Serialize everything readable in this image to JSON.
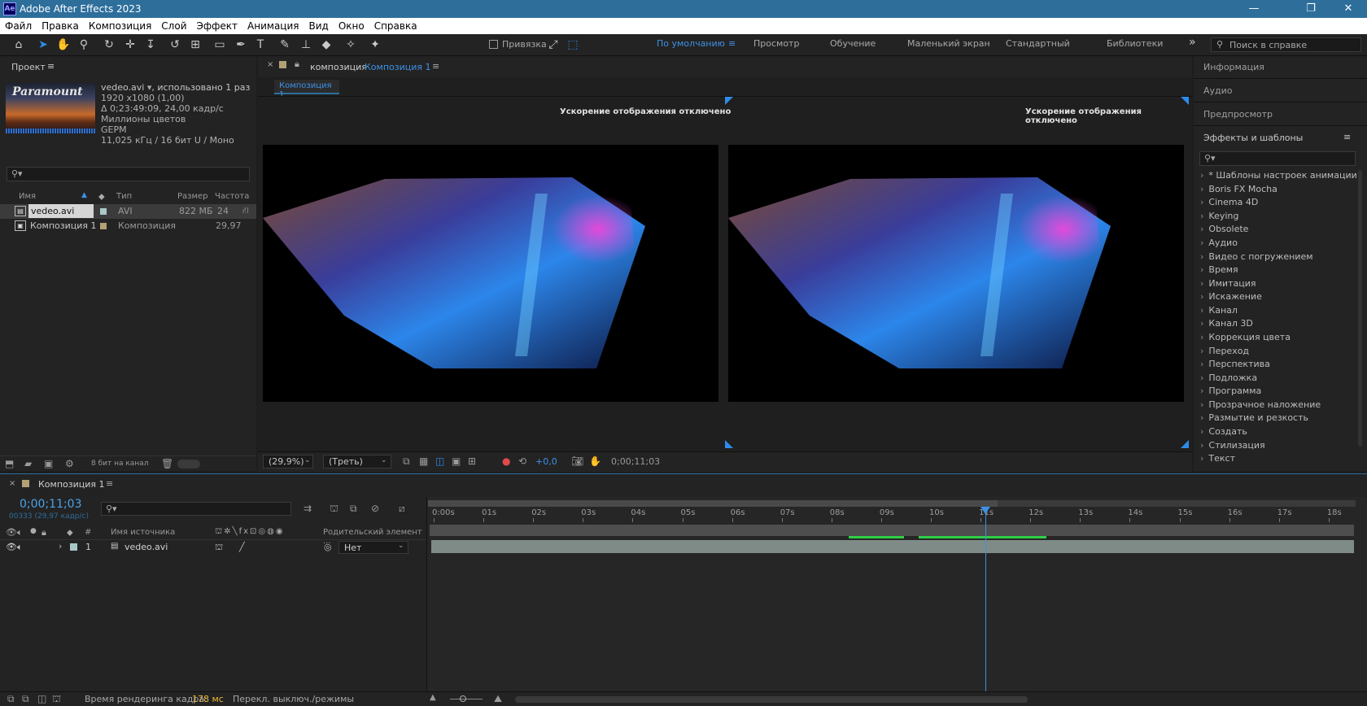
{
  "app": {
    "title": "Adobe After Effects 2023",
    "logo": "Ae"
  },
  "window_controls": {
    "minimize": "—",
    "restore": "❐",
    "close": "✕"
  },
  "menu": [
    "Файл",
    "Правка",
    "Композиция",
    "Слой",
    "Эффект",
    "Анимация",
    "Вид",
    "Окно",
    "Справка"
  ],
  "toolbar": {
    "snap_label": "Привязка",
    "workspaces": [
      "По умолчанию",
      "Просмотр",
      "Обучение",
      "Маленький экран",
      "Стандартный",
      "Библиотеки"
    ],
    "workspace_menu": "≡",
    "more": "»",
    "help_placeholder": "Поиск в справке",
    "tool_icons": [
      "home-icon",
      "selection-tool-icon",
      "hand-tool-icon",
      "zoom-tool-icon",
      "orbit-camera-icon",
      "pan-camera-icon",
      "dolly-camera-icon",
      "rotate-tool-icon",
      "pan-behind-icon",
      "rectangle-tool-icon",
      "pen-tool-icon",
      "type-tool-icon",
      "brush-tool-icon",
      "clone-stamp-icon",
      "eraser-icon",
      "roto-brush-icon",
      "puppet-pin-icon"
    ]
  },
  "project": {
    "title": "Проект",
    "menu": "≡",
    "item_name": "vedeo.avi",
    "usage": ", использовано 1 раз",
    "resolution": "1920 x1080 (1,00)",
    "duration": "Δ 0;23:49:09, 24,00 кадр/с",
    "colors": "Миллионы цветов",
    "codec": "GEPM",
    "audio": "11,025 кГц / 16 бит U / Моно",
    "thumb_text": "Paramount",
    "columns": {
      "name": "Имя",
      "type": "Тип",
      "size": "Размер",
      "rate": "Частота ..."
    },
    "rows": [
      {
        "name": "vedeo.avi",
        "type": "AVI",
        "size": "822 МБ",
        "rate": "24",
        "color": "#a9c8c8"
      },
      {
        "name": "Композиция 1",
        "type": "Композиция",
        "size": "",
        "rate": "29,97",
        "color": "#b3a076"
      }
    ],
    "bit_depth": "8 бит на канал"
  },
  "composition_panel": {
    "tab_prefix": "композиция",
    "tab_name": "Композиция 1",
    "menu": "≡",
    "subtab": "Композиция 1",
    "accel_msg_left": "Ускорение отображения отключено",
    "accel_msg_right": "Ускорение отображения отключено",
    "zoom": "(29,9%)",
    "resolution": "(Треть)",
    "exposure": "+0,0",
    "timecode": "0;00;11;03"
  },
  "right_panels": {
    "info": "Информация",
    "audio": "Аудио",
    "preview": "Предпросмотр",
    "effects_title": "Эффекты и шаблоны",
    "effects_menu": "≡",
    "effects": [
      "* Шаблоны настроек анимации",
      "Boris FX Mocha",
      "Cinema 4D",
      "Keying",
      "Obsolete",
      "Аудио",
      "Видео с погружением",
      "Время",
      "Имитация",
      "Искажение",
      "Канал",
      "Канал 3D",
      "Коррекция цвета",
      "Переход",
      "Перспектива",
      "Подложка",
      "Программа",
      "Прозрачное наложение",
      "Размытие и резкость",
      "Создать",
      "Стилизация",
      "Текст"
    ]
  },
  "timeline": {
    "tab": "Композиция 1",
    "menu": "≡",
    "timecode": "0;00;11;03",
    "frame_info": "00333 (29,97 кадр/с)",
    "col_num": "#",
    "col_source": "Имя источника",
    "col_parent": "Родительский элемент ...",
    "layer": {
      "num": "1",
      "name": "vedeo.avi",
      "parent": "Нет",
      "color": "#a9c8c8"
    },
    "ticks": [
      "0:00s",
      "01s",
      "02s",
      "03s",
      "04s",
      "05s",
      "06s",
      "07s",
      "08s",
      "09s",
      "10s",
      "11s",
      "12s",
      "13s",
      "14s",
      "15s",
      "16s",
      "17s",
      "18s"
    ],
    "playhead_seconds": 11.1
  },
  "statusbar": {
    "render_label": "Время рендеринга кадра:",
    "render_value": "178 мс",
    "toggle_label": "Перекл. выключ./режимы"
  },
  "colors": {
    "accent": "#2d8ceb",
    "titlebar": "#2d6e9b",
    "timeline_time": "#4aa3e8",
    "render_value": "#e7b53c"
  }
}
